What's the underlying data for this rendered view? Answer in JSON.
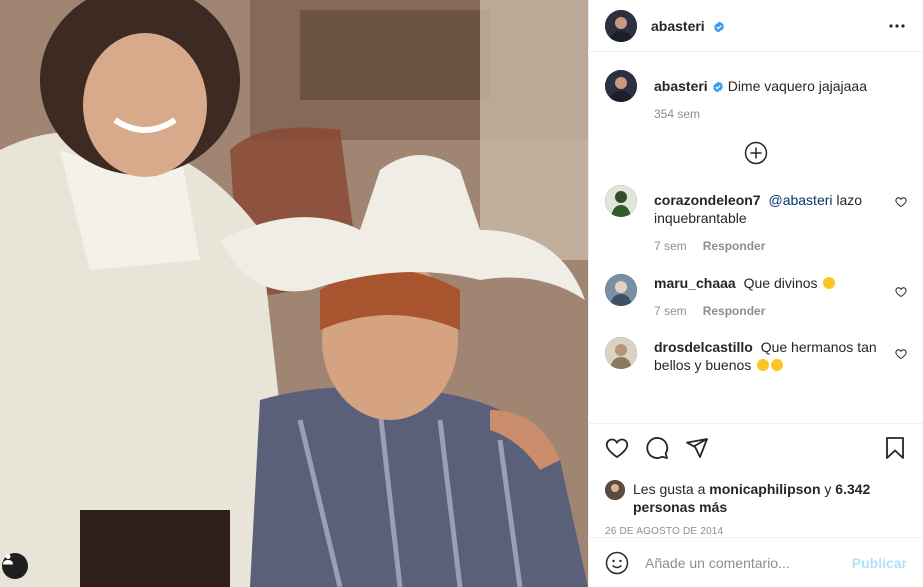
{
  "post": {
    "author": "abasteri",
    "verified": true,
    "more_icon": "more-horizontal-icon"
  },
  "caption": {
    "username": "abasteri",
    "text": "Dime vaquero jajajaaa",
    "time": "354 sem"
  },
  "load_more_icon": "plus-circle-icon",
  "comments": [
    {
      "username": "corazondeleon7",
      "mention": "@abasteri",
      "text": "lazo inquebrantable",
      "time": "7 sem",
      "reply": "Responder"
    },
    {
      "username": "maru_chaaa",
      "text": "Que divinos",
      "emoji": "heart-eyes-emoji",
      "time": "7 sem",
      "reply": "Responder"
    },
    {
      "username": "drosdelcastillo",
      "text": "Que hermanos tan bellos y buenos",
      "emoji": "heart-eyes-emoji"
    }
  ],
  "actions": {
    "like_icon": "heart-icon",
    "comment_icon": "comment-icon",
    "share_icon": "paper-plane-icon",
    "save_icon": "bookmark-icon"
  },
  "likes": {
    "prefix": "Les gusta a",
    "user": "monicaphilipson",
    "connector": "y",
    "count": "6.342 personas más"
  },
  "date": "26 DE AGOSTO DE 2014",
  "add_comment": {
    "placeholder": "Añade un comentario...",
    "publish": "Publicar",
    "emoji_icon": "smile-icon"
  },
  "colors": {
    "verified": "#3897f0",
    "mention": "#00376b",
    "publish_disabled": "#b2dffc",
    "meta": "#8e8e8e"
  }
}
